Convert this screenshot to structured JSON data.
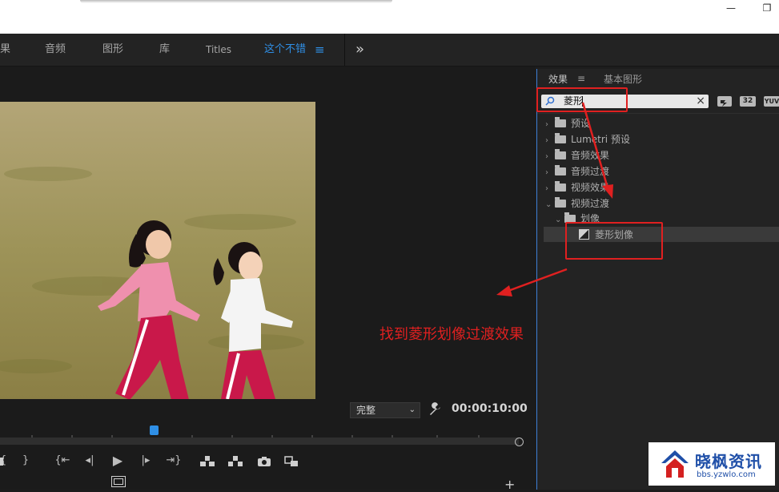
{
  "window": {
    "minimize_glyph": "—",
    "restore_glyph": "❐"
  },
  "tabs": [
    {
      "label": "果"
    },
    {
      "label": "音频"
    },
    {
      "label": "图形"
    },
    {
      "label": "库"
    },
    {
      "label": "Titles"
    },
    {
      "label": "这个不错"
    }
  ],
  "tab_menu_glyph": "≡",
  "overflow_glyph": "»",
  "monitor": {
    "fit_select": "完整",
    "timecode": "00:00:10:00",
    "fit_options": [
      "完整"
    ]
  },
  "effects_panel": {
    "tab_effects": "效果",
    "tab_menu_glyph": "≡",
    "tab_essential_graphics": "基本图形",
    "search": {
      "value": "菱形",
      "clear_glyph": "×"
    },
    "filter_badges": [
      "32",
      "YUV"
    ],
    "tree": [
      {
        "label": "预设",
        "expanded": false,
        "indent": 0,
        "kind": "preset"
      },
      {
        "label": "Lumetri 预设",
        "expanded": false,
        "indent": 0,
        "kind": "preset"
      },
      {
        "label": "音频效果",
        "expanded": false,
        "indent": 0,
        "kind": "folder"
      },
      {
        "label": "音频过渡",
        "expanded": false,
        "indent": 0,
        "kind": "folder"
      },
      {
        "label": "视频效果",
        "expanded": false,
        "indent": 0,
        "kind": "folder"
      },
      {
        "label": "视频过渡",
        "expanded": true,
        "indent": 0,
        "kind": "folder"
      },
      {
        "label": "划像",
        "expanded": true,
        "indent": 1,
        "kind": "folder"
      },
      {
        "label": "菱形划像",
        "expanded": false,
        "indent": 2,
        "kind": "transition",
        "selected": true
      }
    ]
  },
  "annotation": {
    "text": "找到菱形划像过渡效果"
  },
  "logo": {
    "name": "晓枫资讯",
    "url": "bbs.yzwlo.com"
  },
  "colors": {
    "accent": "#2f8fe6",
    "annotation": "#e02020",
    "panel": "#232323"
  }
}
